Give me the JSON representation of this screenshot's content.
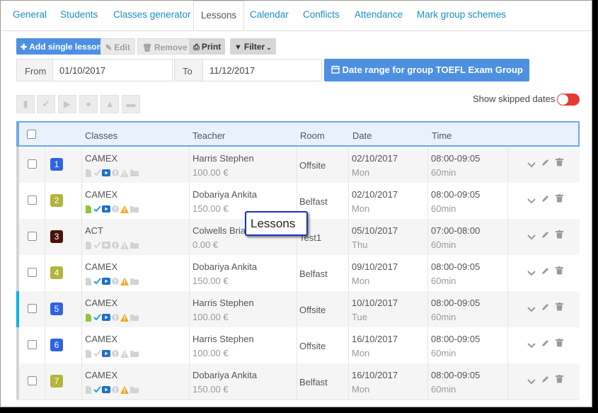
{
  "tabs": [
    "General",
    "Students",
    "Classes generator",
    "Lessons",
    "Calendar",
    "Conflicts",
    "Attendance",
    "Mark group schemes"
  ],
  "active_tab": "Lessons",
  "toolbar": {
    "add": "Add single lesson",
    "edit": "Edit",
    "remove": "Remove",
    "print": "Print",
    "filter": "Filter"
  },
  "date_range": {
    "from_label": "From",
    "from_value": "01/10/2017",
    "to_label": "To",
    "to_value": "11/12/2017",
    "group_button": "Date range for group TOEFL Exam Group"
  },
  "skipped_label": "Show skipped dates",
  "table": {
    "headers": [
      "Classes",
      "Teacher",
      "Room",
      "Date",
      "Time"
    ],
    "rows": [
      {
        "num": "1",
        "color": "#2f63e0",
        "class": "CAMEX",
        "teacher": "Harris Stephen",
        "price": "100.00 €",
        "room": "Offsite",
        "date": "02/10/2017",
        "day": "Mon",
        "time": "08:00-09:05",
        "duration": "60min",
        "icons": [
          "grey-doc",
          "grey-check",
          "blue-video",
          "grey-info",
          "grey-warn",
          "grey-folder"
        ]
      },
      {
        "num": "2",
        "color": "#b3b53c",
        "class": "CAMEX",
        "teacher": "Dobariya Ankita",
        "price": "150.00 €",
        "room": "Belfast",
        "date": "02/10/2017",
        "day": "Mon",
        "time": "08:00-09:05",
        "duration": "60min",
        "icons": [
          "green-doc",
          "blue-check",
          "blue-video",
          "grey-info",
          "orange-warn",
          "grey-folder"
        ]
      },
      {
        "num": "3",
        "color": "#4a1308",
        "class": "ACT",
        "teacher": "Colwells Bria",
        "price": "0.00 €",
        "room": "Test1",
        "date": "05/10/2017",
        "day": "Thu",
        "time": "07:00-08:00",
        "duration": "60min",
        "icons": [
          "grey-doc",
          "grey-check",
          "grey-video",
          "grey-info",
          "grey-warn",
          "grey-folder"
        ]
      },
      {
        "num": "4",
        "color": "#b3b53c",
        "class": "CAMEX",
        "teacher": "Dobariya Ankita",
        "price": "150.00 €",
        "room": "Belfast",
        "date": "09/10/2017",
        "day": "Mon",
        "time": "08:00-09:05",
        "duration": "60min",
        "icons": [
          "grey-doc",
          "blue-check",
          "blue-video",
          "grey-info",
          "orange-warn",
          "grey-folder"
        ]
      },
      {
        "num": "5",
        "color": "#2f63e0",
        "class": "CAMEX",
        "teacher": "Harris Stephen",
        "price": "100.00 €",
        "room": "Offsite",
        "date": "10/10/2017",
        "day": "Tue",
        "time": "08:00-09:05",
        "duration": "60min",
        "icons": [
          "green-doc",
          "blue-check",
          "blue-video",
          "grey-info",
          "orange-warn",
          "grey-folder"
        ]
      },
      {
        "num": "6",
        "color": "#2f63e0",
        "class": "CAMEX",
        "teacher": "Harris Stephen",
        "price": "100.00 €",
        "room": "Offsite",
        "date": "16/10/2017",
        "day": "Mon",
        "time": "08:00-09:05",
        "duration": "60min",
        "icons": [
          "grey-doc",
          "grey-check",
          "blue-video",
          "grey-info",
          "grey-warn",
          "grey-folder"
        ]
      },
      {
        "num": "7",
        "color": "#b3b53c",
        "class": "CAMEX",
        "teacher": "Dobariya Ankita",
        "price": "150.00 €",
        "room": "Belfast",
        "date": "16/10/2017",
        "day": "Mon",
        "time": "08:00-09:05",
        "duration": "60min",
        "icons": [
          "grey-doc",
          "blue-check",
          "blue-video",
          "grey-info",
          "orange-warn",
          "grey-folder"
        ]
      }
    ]
  },
  "tooltip": "Lessons",
  "colors": {
    "accent": "#4d90e2",
    "link": "#1a8fc9",
    "toggle": "#e53935",
    "highlight_stripe": "#00b4e6"
  }
}
